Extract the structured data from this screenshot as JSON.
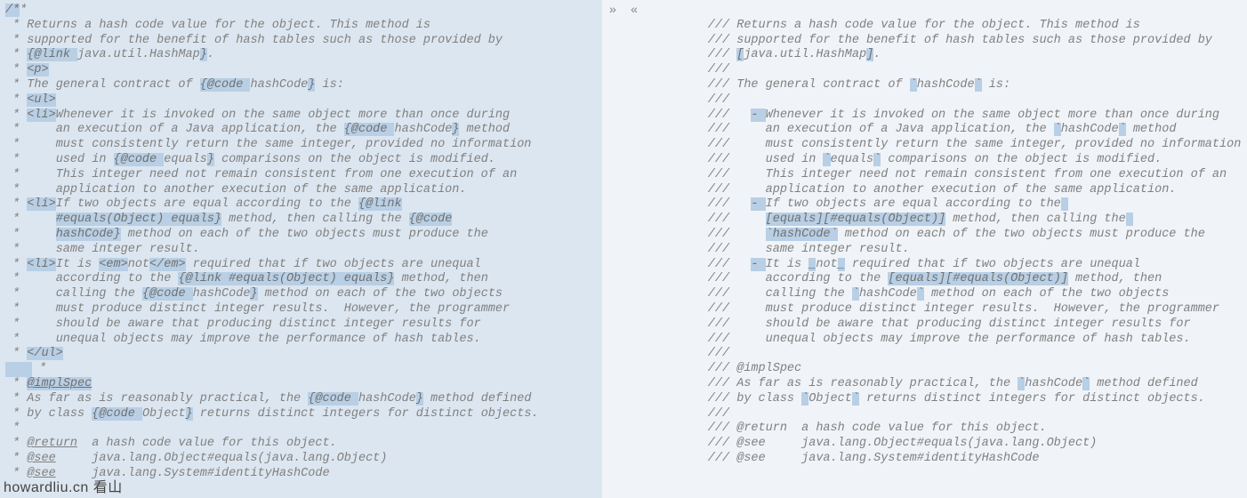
{
  "navigation": {
    "next_glyph": "»",
    "prev_glyph": "«"
  },
  "left": {
    "lines": [
      {
        "segments": [
          {
            "t": "/*",
            "hl": true
          },
          {
            "t": "*"
          }
        ]
      },
      {
        "segments": [
          {
            "t": " * Returns a hash code value for the object. This method is"
          }
        ]
      },
      {
        "segments": [
          {
            "t": " * supported for the benefit of hash tables such as those provided by"
          }
        ]
      },
      {
        "segments": [
          {
            "t": " * "
          },
          {
            "t": "{@link ",
            "hl": true
          },
          {
            "t": "java.util.HashMap"
          },
          {
            "t": "}",
            "hl": true
          },
          {
            "t": "."
          }
        ]
      },
      {
        "segments": [
          {
            "t": " * "
          },
          {
            "t": "<p>",
            "hl": true
          }
        ]
      },
      {
        "segments": [
          {
            "t": " * The general contract of "
          },
          {
            "t": "{@code ",
            "hl": true
          },
          {
            "t": "hashCode"
          },
          {
            "t": "}",
            "hl": true
          },
          {
            "t": " is:"
          }
        ]
      },
      {
        "segments": [
          {
            "t": " * "
          },
          {
            "t": "<ul>",
            "hl": true
          }
        ]
      },
      {
        "segments": [
          {
            "t": " * "
          },
          {
            "t": "<li>",
            "hl": true
          },
          {
            "t": "Whenever it is invoked on the same object more than once during"
          }
        ]
      },
      {
        "segments": [
          {
            "t": " *     an execution of a Java application, the "
          },
          {
            "t": "{@code ",
            "hl": true
          },
          {
            "t": "hashCode"
          },
          {
            "t": "}",
            "hl": true
          },
          {
            "t": " method"
          }
        ]
      },
      {
        "segments": [
          {
            "t": " *     must consistently return the same integer, provided no information"
          }
        ]
      },
      {
        "segments": [
          {
            "t": " *     used in "
          },
          {
            "t": "{@code ",
            "hl": true
          },
          {
            "t": "equals"
          },
          {
            "t": "}",
            "hl": true
          },
          {
            "t": " comparisons on the object is modified."
          }
        ]
      },
      {
        "segments": [
          {
            "t": " *     This integer need not remain consistent from one execution of an"
          }
        ]
      },
      {
        "segments": [
          {
            "t": " *     application to another execution of the same application."
          }
        ]
      },
      {
        "segments": [
          {
            "t": " * "
          },
          {
            "t": "<li>",
            "hl": true
          },
          {
            "t": "If two objects are equal according to the "
          },
          {
            "t": "{@link",
            "hl": true
          }
        ]
      },
      {
        "segments": [
          {
            "t": " *     "
          },
          {
            "t": "#equals(Object) equals}",
            "hl": true
          },
          {
            "t": " method, then calling the "
          },
          {
            "t": "{@code",
            "hl": true
          }
        ]
      },
      {
        "segments": [
          {
            "t": " *     "
          },
          {
            "t": "hashCode}",
            "hl": true
          },
          {
            "t": " method on each of the two objects must produce the"
          }
        ]
      },
      {
        "segments": [
          {
            "t": " *     same integer result."
          }
        ]
      },
      {
        "segments": [
          {
            "t": " * "
          },
          {
            "t": "<li>",
            "hl": true
          },
          {
            "t": "It is "
          },
          {
            "t": "<em>",
            "hl": true
          },
          {
            "t": "not"
          },
          {
            "t": "</em>",
            "hl": true
          },
          {
            "t": " required that if two objects are unequal"
          }
        ]
      },
      {
        "segments": [
          {
            "t": " *     according to the "
          },
          {
            "t": "{@link #equals(Object) equals}",
            "hl": true
          },
          {
            "t": " method, then"
          }
        ]
      },
      {
        "segments": [
          {
            "t": " *     calling the "
          },
          {
            "t": "{@code ",
            "hl": true
          },
          {
            "t": "hashCode"
          },
          {
            "t": "}",
            "hl": true
          },
          {
            "t": " method on each of the two objects"
          }
        ]
      },
      {
        "segments": [
          {
            "t": " *     must produce distinct integer results.  However, the programmer"
          }
        ]
      },
      {
        "segments": [
          {
            "t": " *     should be aware that producing distinct integer results for"
          }
        ]
      },
      {
        "segments": [
          {
            "t": " *     unequal objects may improve the performance of hash tables."
          }
        ]
      },
      {
        "segments": [
          {
            "t": " * "
          },
          {
            "t": "</ul>",
            "hl": true
          }
        ]
      },
      {
        "segments": [
          {
            "t": " *"
          }
        ],
        "pad_before": true
      },
      {
        "segments": [
          {
            "t": " * "
          },
          {
            "t": "@implSpec",
            "hl": true,
            "u": true
          }
        ]
      },
      {
        "segments": [
          {
            "t": " * As far as is reasonably practical, the "
          },
          {
            "t": "{@code ",
            "hl": true
          },
          {
            "t": "hashCode"
          },
          {
            "t": "}",
            "hl": true
          },
          {
            "t": " method defined"
          }
        ]
      },
      {
        "segments": [
          {
            "t": " * by class "
          },
          {
            "t": "{@code ",
            "hl": true
          },
          {
            "t": "Object"
          },
          {
            "t": "}",
            "hl": true
          },
          {
            "t": " returns distinct integers for distinct objects."
          }
        ]
      },
      {
        "segments": [
          {
            "t": " *"
          }
        ]
      },
      {
        "segments": [
          {
            "t": " * "
          },
          {
            "t": "@return",
            "u": true
          },
          {
            "t": "  a hash code value for this object."
          }
        ]
      },
      {
        "segments": [
          {
            "t": " * "
          },
          {
            "t": "@see",
            "u": true
          },
          {
            "t": "     java.lang.Object#equals(java.lang.Object)"
          }
        ]
      },
      {
        "segments": [
          {
            "t": " * "
          },
          {
            "t": "@see",
            "u": true
          },
          {
            "t": "     java.lang.System#identityHashCode"
          }
        ]
      }
    ]
  },
  "right": {
    "lines": [
      {
        "segments": [
          {
            "t": ""
          }
        ]
      },
      {
        "segments": [
          {
            "t": "        /// Returns a hash code value for the object. This method is"
          }
        ]
      },
      {
        "segments": [
          {
            "t": "        /// supported for the benefit of hash tables such as those provided by"
          }
        ]
      },
      {
        "segments": [
          {
            "t": "        /// "
          },
          {
            "t": "[",
            "hl": true
          },
          {
            "t": "java.util.HashMap"
          },
          {
            "t": "]",
            "hl": true
          },
          {
            "t": "."
          }
        ]
      },
      {
        "segments": [
          {
            "t": "        ///"
          }
        ]
      },
      {
        "segments": [
          {
            "t": "        /// The general contract of "
          },
          {
            "t": "`",
            "hl": true
          },
          {
            "t": "hashCode"
          },
          {
            "t": "`",
            "hl": true
          },
          {
            "t": " is:"
          }
        ]
      },
      {
        "segments": [
          {
            "t": "        ///"
          }
        ]
      },
      {
        "segments": [
          {
            "t": "        ///   "
          },
          {
            "t": "- ",
            "hl": true
          },
          {
            "t": "Whenever it is invoked on the same object more than once during"
          }
        ]
      },
      {
        "segments": [
          {
            "t": "        ///     an execution of a Java application, the "
          },
          {
            "t": "`",
            "hl": true
          },
          {
            "t": "hashCode"
          },
          {
            "t": "`",
            "hl": true
          },
          {
            "t": " method"
          }
        ]
      },
      {
        "segments": [
          {
            "t": "        ///     must consistently return the same integer, provided no information"
          }
        ]
      },
      {
        "segments": [
          {
            "t": "        ///     used in "
          },
          {
            "t": "`",
            "hl": true
          },
          {
            "t": "equals"
          },
          {
            "t": "`",
            "hl": true
          },
          {
            "t": " comparisons on the object is modified."
          }
        ]
      },
      {
        "segments": [
          {
            "t": "        ///     This integer need not remain consistent from one execution of an"
          }
        ]
      },
      {
        "segments": [
          {
            "t": "        ///     application to another execution of the same application."
          }
        ]
      },
      {
        "segments": [
          {
            "t": "        ///   "
          },
          {
            "t": "- ",
            "hl": true
          },
          {
            "t": "If two objects are equal according to the"
          },
          {
            "t": " ",
            "hl": true
          }
        ]
      },
      {
        "segments": [
          {
            "t": "        ///     "
          },
          {
            "t": "[equals][#equals(Object)]",
            "hl": true
          },
          {
            "t": " method, then calling the"
          },
          {
            "t": " ",
            "hl": true
          }
        ]
      },
      {
        "segments": [
          {
            "t": "        ///     "
          },
          {
            "t": "`hashCode`",
            "hl": true
          },
          {
            "t": " method on each of the two objects must produce the"
          }
        ]
      },
      {
        "segments": [
          {
            "t": "        ///     same integer result."
          }
        ]
      },
      {
        "segments": [
          {
            "t": "        ///   "
          },
          {
            "t": "- ",
            "hl": true
          },
          {
            "t": "It is "
          },
          {
            "t": "_",
            "hl": true
          },
          {
            "t": "not"
          },
          {
            "t": "_",
            "hl": true
          },
          {
            "t": " required that if two objects are unequal"
          }
        ]
      },
      {
        "segments": [
          {
            "t": "        ///     according to the "
          },
          {
            "t": "[equals][#equals(Object)]",
            "hl": true
          },
          {
            "t": " method, then"
          }
        ]
      },
      {
        "segments": [
          {
            "t": "        ///     calling the "
          },
          {
            "t": "`",
            "hl": true
          },
          {
            "t": "hashCode"
          },
          {
            "t": "`",
            "hl": true
          },
          {
            "t": " method on each of the two objects"
          }
        ]
      },
      {
        "segments": [
          {
            "t": "        ///     must produce distinct integer results.  However, the programmer"
          }
        ]
      },
      {
        "segments": [
          {
            "t": "        ///     should be aware that producing distinct integer results for"
          }
        ]
      },
      {
        "segments": [
          {
            "t": "        ///     unequal objects may improve the performance of hash tables."
          }
        ]
      },
      {
        "segments": [
          {
            "t": "        ///"
          }
        ]
      },
      {
        "segments": [
          {
            "t": "        /// @implSpec"
          }
        ]
      },
      {
        "segments": [
          {
            "t": "        /// As far as is reasonably practical, the "
          },
          {
            "t": "`",
            "hl": true
          },
          {
            "t": "hashCode"
          },
          {
            "t": "`",
            "hl": true
          },
          {
            "t": " method defined"
          }
        ]
      },
      {
        "segments": [
          {
            "t": "        /// by class "
          },
          {
            "t": "`",
            "hl": true
          },
          {
            "t": "Object"
          },
          {
            "t": "`",
            "hl": true
          },
          {
            "t": " returns distinct integers for distinct objects."
          }
        ]
      },
      {
        "segments": [
          {
            "t": "        ///"
          }
        ]
      },
      {
        "segments": [
          {
            "t": "        /// @return  a hash code value for this object."
          }
        ]
      },
      {
        "segments": [
          {
            "t": "        /// @see     java.lang.Object#equals(java.lang.Object)"
          }
        ]
      },
      {
        "segments": [
          {
            "t": "        /// @see     java.lang.System#identityHashCode"
          }
        ]
      }
    ]
  },
  "watermark": "howardliu.cn 看山"
}
